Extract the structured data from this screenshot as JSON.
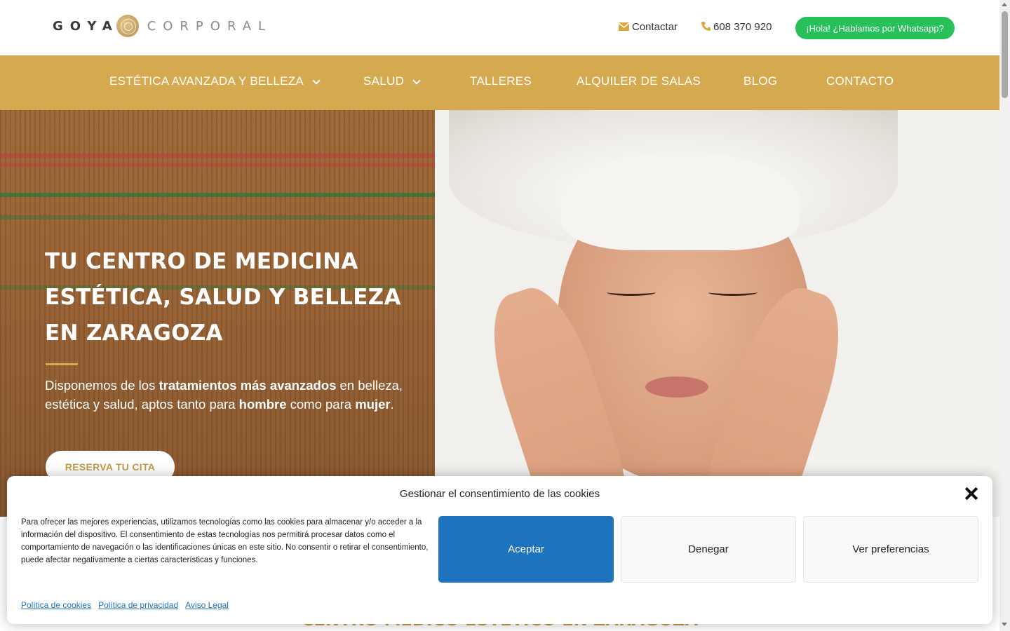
{
  "header": {
    "logo_left": "GOYA",
    "logo_right": "CORPORAL",
    "contact_label": "Contactar",
    "phone": "608 370 920",
    "whatsapp_label": "¡Hola! ¿Hablamos por Whatsapp?"
  },
  "nav": {
    "items": [
      {
        "label": "ESTÉTICA AVANZADA Y BELLEZA"
      },
      {
        "label": "SALUD"
      },
      {
        "label": "TALLERES"
      },
      {
        "label": "ALQUILER DE SALAS"
      },
      {
        "label": "BLOG"
      },
      {
        "label": "CONTACTO"
      }
    ]
  },
  "hero": {
    "title_line1": "TU CENTRO DE MEDICINA",
    "title_line2": "ESTÉTICA, SALUD Y BELLEZA",
    "title_line3": "EN ZARAGOZA",
    "text_1": "Disponemos de los ",
    "text_bold_1": "tratamientos más avanzados",
    "text_2": " en belleza, estética y salud, aptos tanto para ",
    "text_bold_2": "hombre",
    "text_3": " como para ",
    "text_bold_3": "mujer",
    "text_4": ".",
    "cta_label": "RESERVA TU CITA"
  },
  "below": {
    "heading": "CENTRO MÉDICO ESTÉTICO EN ZARAGOZA"
  },
  "cookie": {
    "title": "Gestionar el consentimiento de las cookies",
    "body": "Para ofrecer las mejores experiencias, utilizamos tecnologías como las cookies para almacenar y/o acceder a la información del dispositivo. El consentimiento de estas tecnologías nos permitirá procesar datos como el comportamiento de navegación o las identificaciones únicas en este sitio. No consentir o retirar el consentimiento, puede afectar negativamente a ciertas características y funciones.",
    "accept_label": "Aceptar",
    "deny_label": "Denegar",
    "prefs_label": "Ver preferencias",
    "links": [
      "Política de cookies",
      "Política de privacidad",
      "Aviso Legal"
    ]
  },
  "colors": {
    "brand_gold": "#d4a94f",
    "whatsapp_green": "#27c05a",
    "accept_blue": "#1e73be"
  },
  "icons": {
    "email": "envelope-icon",
    "phone": "phone-icon",
    "dropdown": "chevron-down-icon",
    "close": "close-icon"
  }
}
